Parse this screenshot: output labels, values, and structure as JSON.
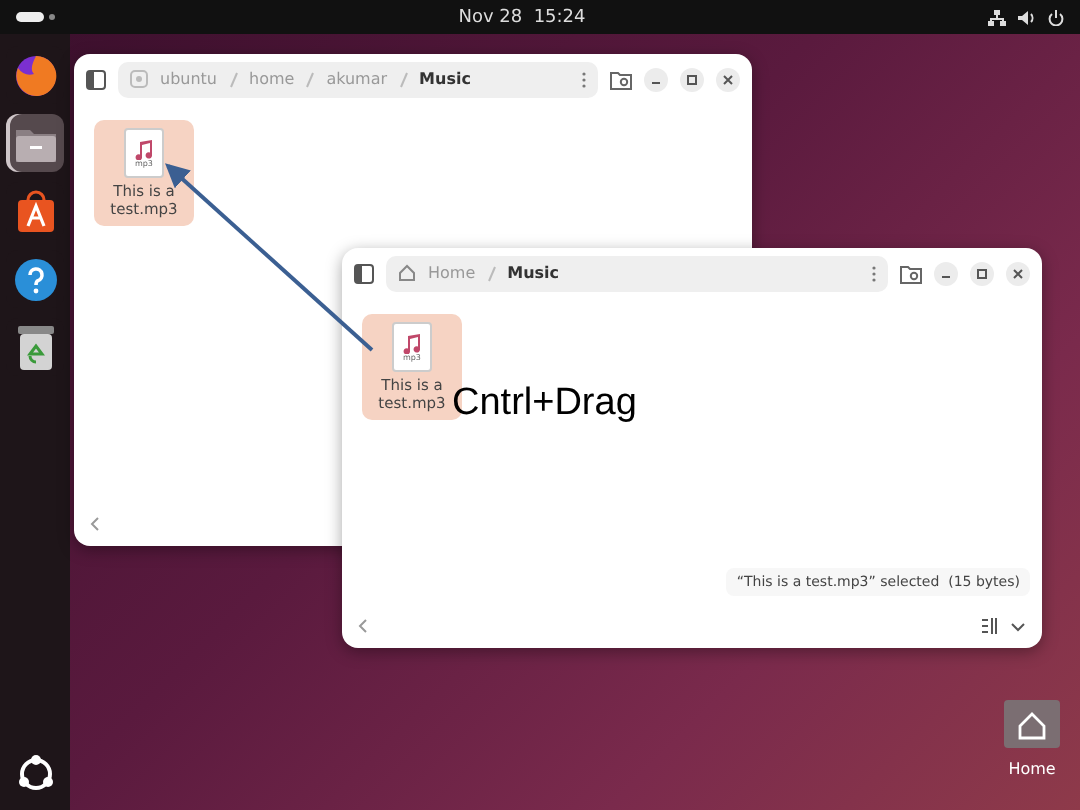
{
  "top_bar": {
    "clock": "Nov 28  15:24"
  },
  "dock": {
    "apps": [
      {
        "kind": "browser",
        "selected": false
      },
      {
        "kind": "files",
        "selected": true
      },
      {
        "kind": "store",
        "selected": false
      },
      {
        "kind": "help",
        "selected": false
      },
      {
        "kind": "trash",
        "selected": false
      }
    ]
  },
  "windows": [
    {
      "path": [
        {
          "label": "ubuntu",
          "kind": "drive",
          "current": false
        },
        {
          "label": "home",
          "kind": "folder",
          "current": false
        },
        {
          "label": "akumar",
          "kind": "folder",
          "current": false
        },
        {
          "label": "Music",
          "kind": "folder",
          "current": true
        }
      ],
      "files": [
        {
          "name": "This is a test.mp3",
          "type": "mp3",
          "selected": true
        }
      ]
    },
    {
      "path": [
        {
          "label": "Home",
          "kind": "home",
          "current": false
        },
        {
          "label": "Music",
          "kind": "folder",
          "current": true
        }
      ],
      "files": [
        {
          "name": "This is a test.mp3",
          "type": "mp3",
          "selected": true
        }
      ],
      "status": "“This is a test.mp3” selected  (15 bytes)"
    }
  ],
  "desktop_icons": [
    {
      "label": "Home"
    }
  ],
  "annotation": {
    "label": "Cntrl+Drag"
  }
}
